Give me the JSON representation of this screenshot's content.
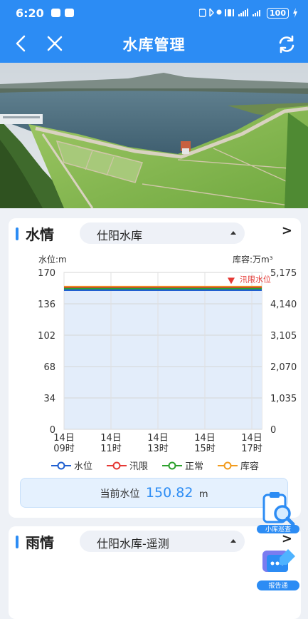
{
  "status": {
    "time": "6:20",
    "battery": "100",
    "signal_icons": [
      "nfc-icon",
      "bluetooth-icon",
      "location-icon",
      "vibrate-icon",
      "signal-icon",
      "signal-icon",
      "charging-icon"
    ]
  },
  "nav": {
    "title": "水库管理"
  },
  "water": {
    "title": "水情",
    "reservoir": "仕阳水库",
    "more": ">",
    "current_label": "当前水位",
    "current_value": "150.82",
    "current_unit": "m"
  },
  "chart_data": {
    "type": "line",
    "ylabel": "水位:m",
    "y2label": "库容:万m³",
    "ylim": [
      0,
      170
    ],
    "yticks": [
      "170",
      "136",
      "102",
      "68",
      "34",
      "0"
    ],
    "y2ticks": [
      "5,175",
      "4,140",
      "3,105",
      "2,070",
      "1,035",
      "0"
    ],
    "x": [
      "14日\n09时",
      "14日\n11时",
      "14日\n13时",
      "14日\n15时",
      "14日\n17时"
    ],
    "x_ticks_day": [
      "14日",
      "14日",
      "14日",
      "14日",
      "14日"
    ],
    "x_ticks_hour": [
      "09时",
      "11时",
      "13时",
      "15时",
      "17时"
    ],
    "annotation": "汛限水位",
    "series": [
      {
        "name": "水位",
        "color": "#1f5fd0",
        "values": [
          150.82,
          150.82,
          150.82,
          150.82,
          150.82
        ]
      },
      {
        "name": "汛限",
        "color": "#e53935",
        "values": [
          153.5,
          153.5,
          153.5,
          153.5,
          153.5
        ]
      },
      {
        "name": "正常",
        "color": "#2ca02c",
        "values": [
          153.5,
          153.5,
          153.5,
          153.5,
          153.5
        ]
      },
      {
        "name": "库容",
        "color": "#f29b1d",
        "values": [
          154.5,
          154.5,
          154.5,
          154.5,
          154.5
        ]
      }
    ]
  },
  "rain": {
    "title": "雨情",
    "reservoir": "仕阳水库-遥测",
    "more": ">"
  },
  "floats": [
    {
      "label": "小库巡查",
      "icon": "inspection-icon"
    },
    {
      "label": "报告通",
      "icon": "report-icon"
    }
  ]
}
